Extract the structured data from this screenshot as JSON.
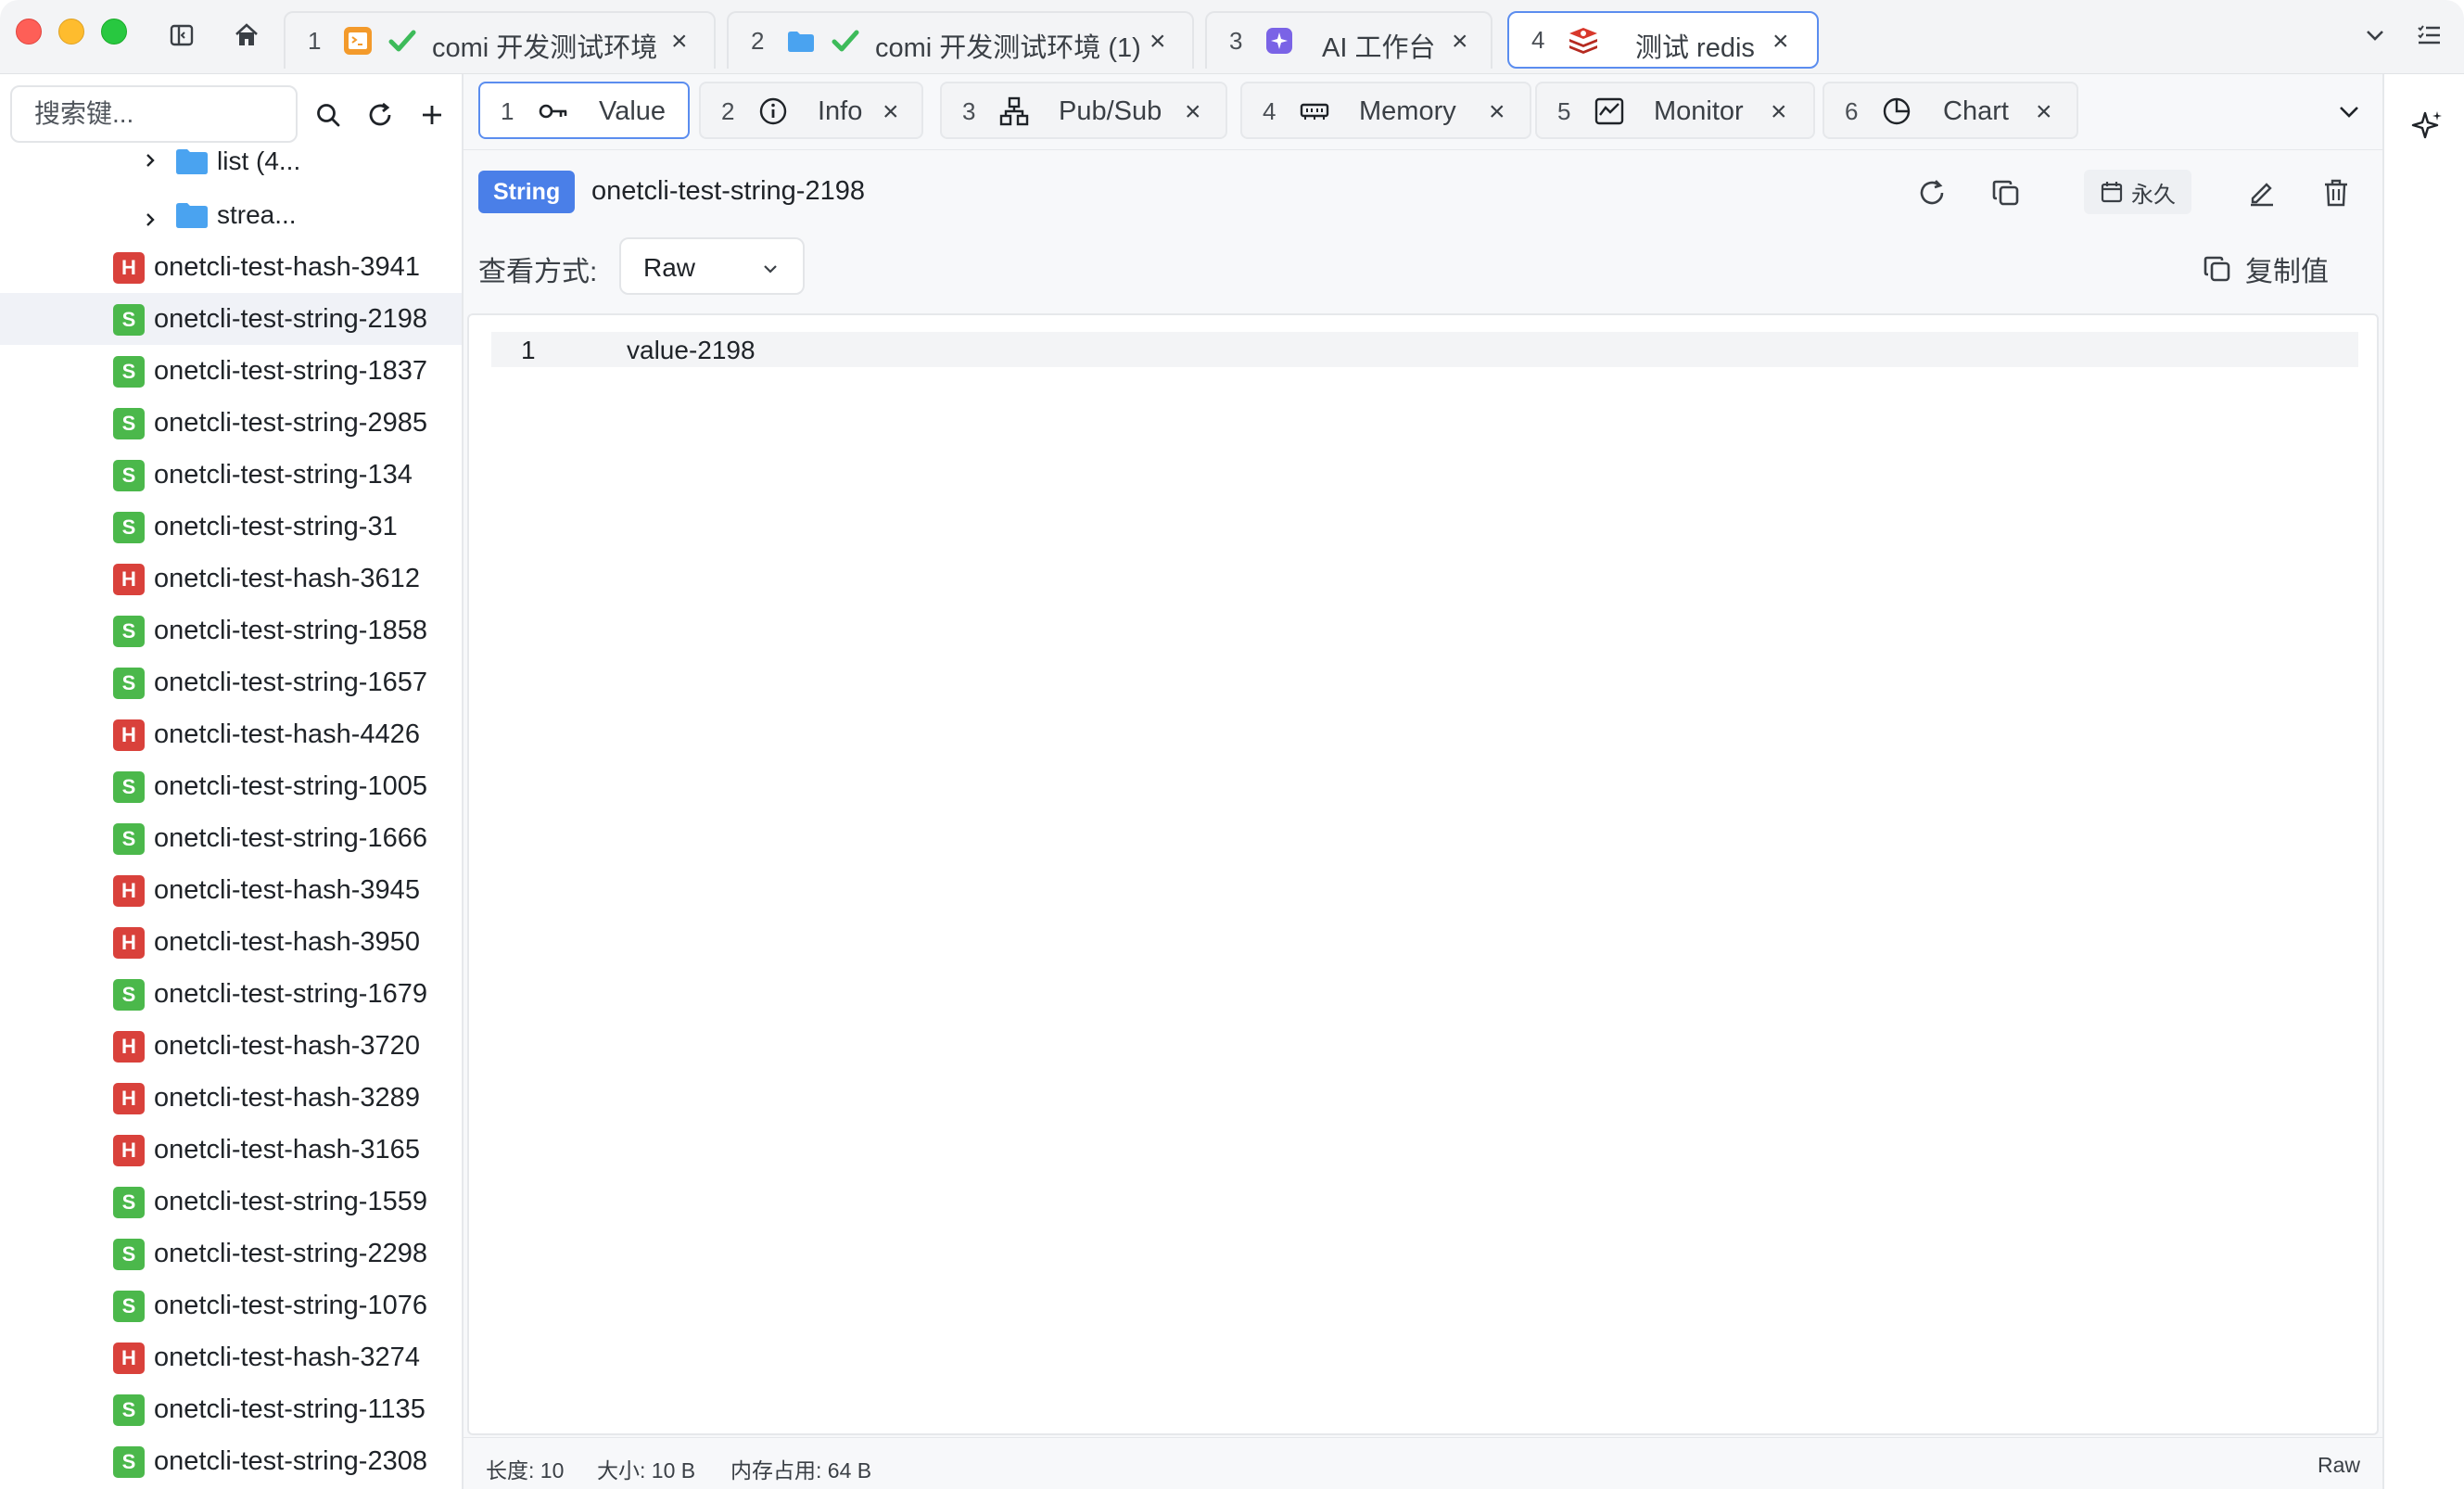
{
  "window": {
    "tabs": [
      {
        "num": "1",
        "label": "comi 开发测试环境",
        "icon": "terminal-icon"
      },
      {
        "num": "2",
        "label": "comi 开发测试环境 (1)",
        "icon": "folder-icon"
      },
      {
        "num": "3",
        "label": "AI 工作台",
        "icon": "ai-icon"
      },
      {
        "num": "4",
        "label": "测试 redis",
        "icon": "redis-icon"
      }
    ],
    "close_glyph": "×"
  },
  "sidebar": {
    "search_placeholder": "搜索键...",
    "folders": [
      {
        "label": "list (4..."
      },
      {
        "label": "strea..."
      }
    ],
    "keys": [
      {
        "type": "H",
        "name": "onetcli-test-hash-3941"
      },
      {
        "type": "S",
        "name": "onetcli-test-string-2198",
        "selected": true
      },
      {
        "type": "S",
        "name": "onetcli-test-string-1837"
      },
      {
        "type": "S",
        "name": "onetcli-test-string-2985"
      },
      {
        "type": "S",
        "name": "onetcli-test-string-134"
      },
      {
        "type": "S",
        "name": "onetcli-test-string-31"
      },
      {
        "type": "H",
        "name": "onetcli-test-hash-3612"
      },
      {
        "type": "S",
        "name": "onetcli-test-string-1858"
      },
      {
        "type": "S",
        "name": "onetcli-test-string-1657"
      },
      {
        "type": "H",
        "name": "onetcli-test-hash-4426"
      },
      {
        "type": "S",
        "name": "onetcli-test-string-1005"
      },
      {
        "type": "S",
        "name": "onetcli-test-string-1666"
      },
      {
        "type": "H",
        "name": "onetcli-test-hash-3945"
      },
      {
        "type": "H",
        "name": "onetcli-test-hash-3950"
      },
      {
        "type": "S",
        "name": "onetcli-test-string-1679"
      },
      {
        "type": "H",
        "name": "onetcli-test-hash-3720"
      },
      {
        "type": "H",
        "name": "onetcli-test-hash-3289"
      },
      {
        "type": "H",
        "name": "onetcli-test-hash-3165"
      },
      {
        "type": "S",
        "name": "onetcli-test-string-1559"
      },
      {
        "type": "S",
        "name": "onetcli-test-string-2298"
      },
      {
        "type": "S",
        "name": "onetcli-test-string-1076"
      },
      {
        "type": "H",
        "name": "onetcli-test-hash-3274"
      },
      {
        "type": "S",
        "name": "onetcli-test-string-1135"
      },
      {
        "type": "S",
        "name": "onetcli-test-string-2308"
      }
    ]
  },
  "subtabs": [
    {
      "num": "1",
      "label": "Value",
      "icon": "key-icon",
      "active": true
    },
    {
      "num": "2",
      "label": "Info",
      "icon": "info-icon"
    },
    {
      "num": "3",
      "label": "Pub/Sub",
      "icon": "network-icon"
    },
    {
      "num": "4",
      "label": "Memory",
      "icon": "memory-icon"
    },
    {
      "num": "5",
      "label": "Monitor",
      "icon": "monitor-icon"
    },
    {
      "num": "6",
      "label": "Chart",
      "icon": "pie-chart-icon"
    }
  ],
  "key_detail": {
    "type": "String",
    "name": "onetcli-test-string-2198",
    "ttl": "永久",
    "view_label": "查看方式:",
    "view_mode": "Raw",
    "copy_value": "复制值",
    "lines": [
      {
        "no": "1",
        "text": "value-2198"
      }
    ]
  },
  "status": {
    "length": "长度: 10",
    "size": "大小: 10 B",
    "memory": "内存占用: 64 B",
    "format": "Raw"
  },
  "colors": {
    "accent": "#5b8def",
    "badge_string": "#4bb84b",
    "badge_hash": "#d9413b",
    "type_badge": "#4a7fe8"
  }
}
